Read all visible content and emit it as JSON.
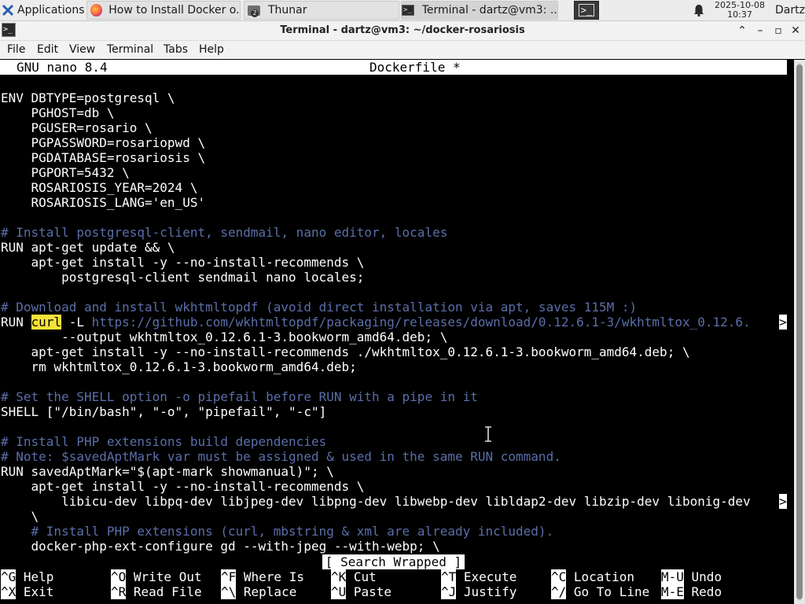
{
  "panel": {
    "applications": "Applications",
    "tasks": [
      "How to Install Docker o...",
      "Thunar",
      "Terminal - dartz@vm3: ..."
    ],
    "thunar_badge": "2",
    "clock_date": "2025-10-08",
    "clock_time": "10:37",
    "user": "Dartz"
  },
  "window": {
    "title": "Terminal - dartz@vm3: ~/docker-rosariosis",
    "minimize": "⌃",
    "iconify": "–",
    "maximize": "▫",
    "close": "✕"
  },
  "menu": [
    "File",
    "Edit",
    "View",
    "Terminal",
    "Tabs",
    "Help"
  ],
  "nano": {
    "version": "GNU nano 8.4",
    "filename": "Dockerfile *",
    "status": "[ Search Wrapped ]"
  },
  "lines": {
    "l1": "ENV DBTYPE=postgresql \\",
    "l2": "    PGHOST=db \\",
    "l3": "    PGUSER=rosario \\",
    "l4": "    PGPASSWORD=rosariopwd \\",
    "l5": "    PGDATABASE=rosariosis \\",
    "l6": "    PGPORT=5432 \\",
    "l7": "    ROSARIOSIS_YEAR=2024 \\",
    "l8": "    ROSARIOSIS_LANG='en_US'",
    "c1": "# Install postgresql-client, sendmail, nano editor, locales",
    "l9": "RUN apt-get update && \\",
    "l10": "    apt-get install -y --no-install-recommends \\",
    "l11": "        postgresql-client sendmail nano locales;",
    "c2": "# Download and install wkhtmltopdf (avoid direct installation via apt, saves 115M :)",
    "l12_pre": "RUN ",
    "l12_hl": "curl",
    "l12_mid": " -L ",
    "l12_url": "https://github.com/wkhtmltopdf/packaging/releases/download/0.12.6.1-3/wkhtmltox_0.12.6.",
    "overflow_mark": ">",
    "l13": "        --output wkhtmltox_0.12.6.1-3.bookworm_amd64.deb; \\",
    "l14": "    apt-get install -y --no-install-recommends ./wkhtmltox_0.12.6.1-3.bookworm_amd64.deb; \\",
    "l15": "    rm wkhtmltox_0.12.6.1-3.bookworm_amd64.deb;",
    "c3": "# Set the SHELL option -o pipefail before RUN with a pipe in it",
    "l16": "SHELL [\"/bin/bash\", \"-o\", \"pipefail\", \"-c\"]",
    "c4": "# Install PHP extensions build dependencies",
    "c5": "# Note: $savedAptMark var must be assigned & used in the same RUN command.",
    "l17": "RUN savedAptMark=\"$(apt-mark showmanual)\"; \\",
    "l18": "    apt-get install -y --no-install-recommends \\",
    "l19": "        libicu-dev libpq-dev libjpeg-dev libpng-dev libwebp-dev libldap2-dev libzip-dev libonig-dev",
    "l20": "    \\",
    "c6": "    # Install PHP extensions (curl, mbstring & xml are already included).",
    "l21": "    docker-php-ext-configure gd --with-jpeg --with-webp; \\"
  },
  "shortcuts": [
    {
      "key": "^G",
      "label": " Help"
    },
    {
      "key": "^O",
      "label": " Write Out"
    },
    {
      "key": "^F",
      "label": " Where Is"
    },
    {
      "key": "^K",
      "label": " Cut"
    },
    {
      "key": "^T",
      "label": " Execute"
    },
    {
      "key": "^C",
      "label": " Location"
    },
    {
      "key": "M-U",
      "label": " Undo"
    },
    {
      "key": "^X",
      "label": " Exit"
    },
    {
      "key": "^R",
      "label": " Read File"
    },
    {
      "key": "^\\",
      "label": " Replace"
    },
    {
      "key": "^U",
      "label": " Paste"
    },
    {
      "key": "^J",
      "label": " Justify"
    },
    {
      "key": "^/",
      "label": " Go To Line"
    },
    {
      "key": "M-E",
      "label": " Redo"
    }
  ]
}
